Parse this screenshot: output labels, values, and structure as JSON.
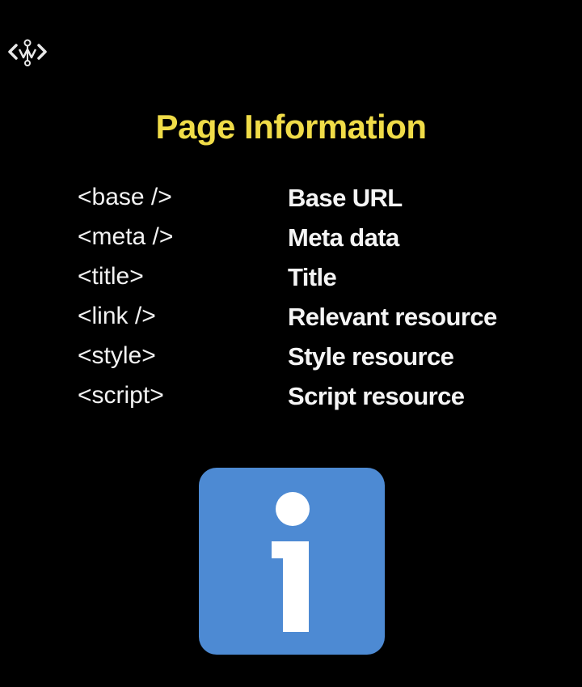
{
  "title": "Page Information",
  "tags": [
    {
      "tag": "<base />",
      "description": "Base URL"
    },
    {
      "tag": "<meta />",
      "description": "Meta data"
    },
    {
      "tag": "<title>",
      "description": "Title"
    },
    {
      "tag": "<link />",
      "description": "Relevant resource"
    },
    {
      "tag": "<style>",
      "description": "Style resource"
    },
    {
      "tag": "<script>",
      "description": "Script resource"
    }
  ],
  "icons": {
    "logo": "code-brackets-logo-icon",
    "info": "info-icon"
  },
  "colors": {
    "background": "#000000",
    "title": "#f0dc48",
    "text": "#f2f2f2",
    "info_tile": "#4d8ad3"
  }
}
